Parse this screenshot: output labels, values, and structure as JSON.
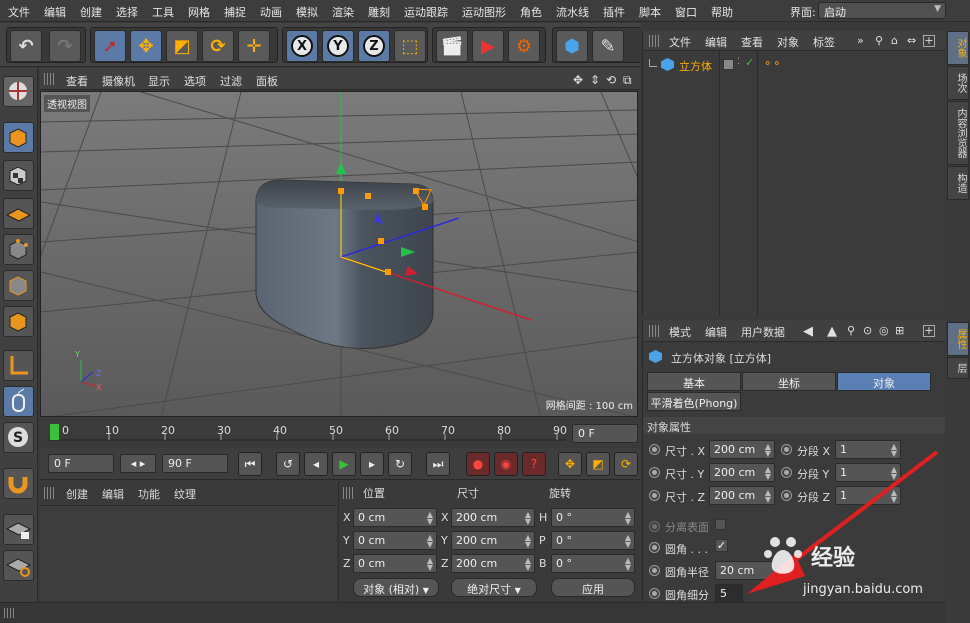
{
  "menu": [
    "文件",
    "编辑",
    "创建",
    "选择",
    "工具",
    "网格",
    "捕捉",
    "动画",
    "模拟",
    "渲染",
    "雕刻",
    "运动跟踪",
    "运动图形",
    "角色",
    "流水线",
    "插件",
    "脚本",
    "窗口",
    "帮助"
  ],
  "layout": {
    "label": "界面:",
    "value": "启动"
  },
  "toolbar": {
    "x": "X",
    "y": "Y",
    "z": "Z"
  },
  "viewport": {
    "menu": [
      "查看",
      "摄像机",
      "显示",
      "选项",
      "过滤",
      "面板"
    ],
    "label": "透视视图",
    "grid_spacing": "网格间距 : 100 cm",
    "axis_y": "Y",
    "axis_z": "Z",
    "axis_x": "X"
  },
  "timeline": {
    "ticks": [
      "0",
      "10",
      "20",
      "30",
      "40",
      "50",
      "60",
      "70",
      "80",
      "90"
    ],
    "current": "0 F",
    "start": "0 F",
    "end": "90 F"
  },
  "material": {
    "menu": [
      "创建",
      "编辑",
      "功能",
      "纹理"
    ]
  },
  "coords": {
    "headers": [
      "位置",
      "尺寸",
      "旋转"
    ],
    "rows": [
      {
        "a": "X",
        "av": "0 cm",
        "b": "X",
        "bv": "200 cm",
        "c": "H",
        "cv": "0 °"
      },
      {
        "a": "Y",
        "av": "0 cm",
        "b": "Y",
        "bv": "200 cm",
        "c": "P",
        "cv": "0 °"
      },
      {
        "a": "Z",
        "av": "0 cm",
        "b": "Z",
        "bv": "200 cm",
        "c": "B",
        "cv": "0 °"
      }
    ],
    "mode": "对象 (相对)",
    "size_mode": "绝对尺寸",
    "apply": "应用"
  },
  "objects": {
    "menu": [
      "文件",
      "编辑",
      "查看",
      "对象",
      "标签"
    ],
    "item": "立方体"
  },
  "attributes": {
    "menu": [
      "模式",
      "编辑",
      "用户数据"
    ],
    "title": "立方体对象 [立方体]",
    "tabs": [
      "基本",
      "坐标",
      "对象"
    ],
    "phong_tab": "平滑着色(Phong)",
    "section": "对象属性",
    "size_rows": [
      {
        "label": "尺寸 . X",
        "value": "200 cm",
        "seg_label": "分段 X",
        "seg": "1"
      },
      {
        "label": "尺寸 . Y",
        "value": "200 cm",
        "seg_label": "分段 Y",
        "seg": "1"
      },
      {
        "label": "尺寸 . Z",
        "value": "200 cm",
        "seg_label": "分段 Z",
        "seg": "1"
      }
    ],
    "separate": "分离表面",
    "fillet": "圆角 . . .",
    "fillet_check": "✓",
    "fillet_radius_label": "圆角半径",
    "fillet_radius": "20 cm",
    "fillet_sub_label": "圆角细分",
    "fillet_sub": "5"
  },
  "right_tabs": [
    "对象",
    "场次",
    "内容浏览器",
    "构造"
  ],
  "right_tabs2": [
    "属性",
    "层"
  ],
  "watermark": {
    "text": "经验",
    "url": "jingyan.baidu.com"
  }
}
